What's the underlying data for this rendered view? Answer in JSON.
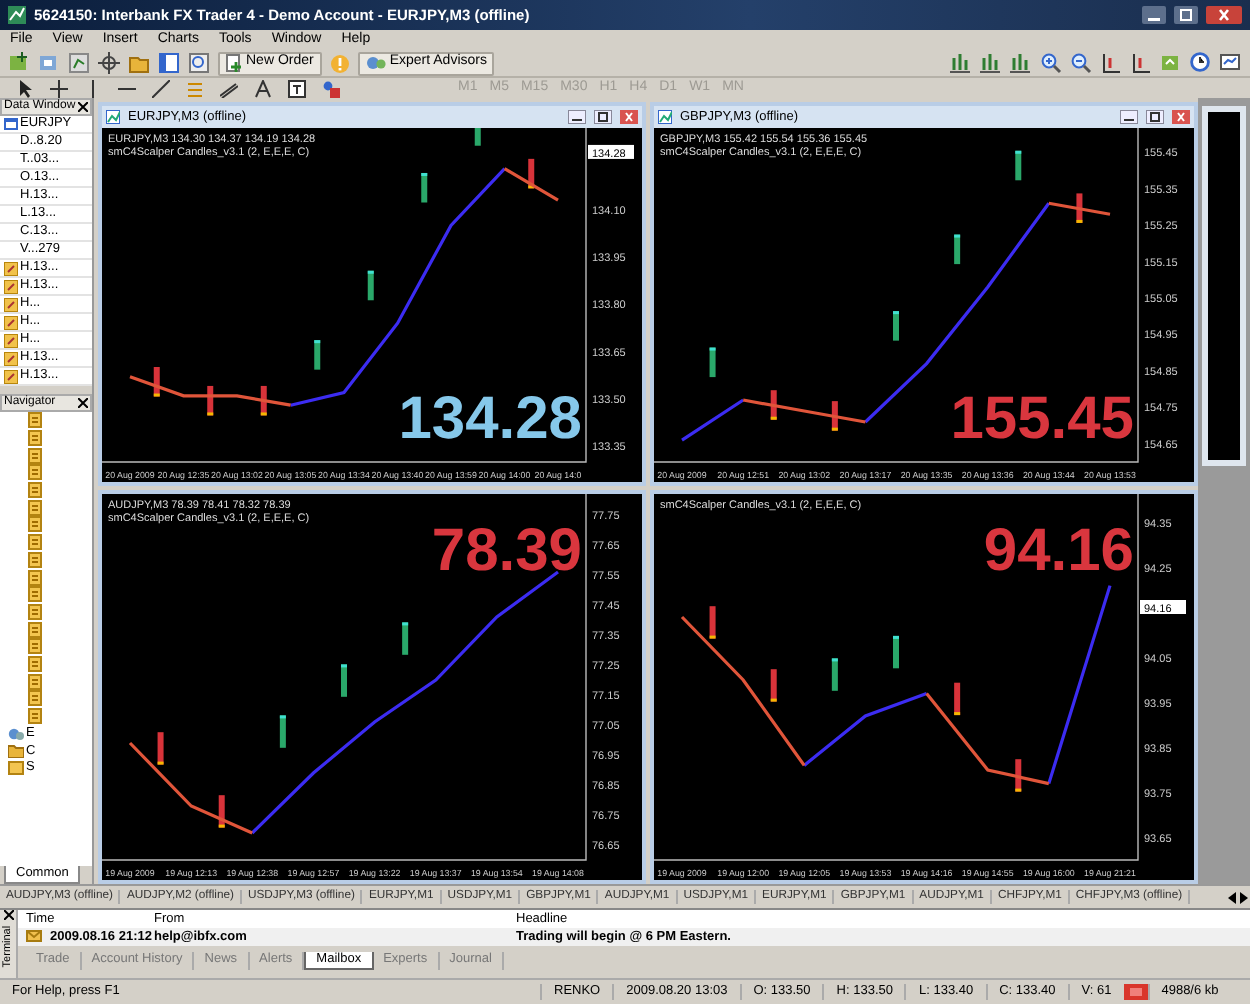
{
  "window": {
    "title": "5624150: Interbank FX Trader 4 - Demo Account - EURJPY,M3 (offline)"
  },
  "menu": [
    "File",
    "View",
    "Insert",
    "Charts",
    "Tools",
    "Window",
    "Help"
  ],
  "toolbar": {
    "buttons": [
      {
        "label": "New Order"
      },
      {
        "label": "Expert Advisors"
      }
    ],
    "periods": [
      {
        "label": "M1",
        "disabled": true
      },
      {
        "label": "M5",
        "disabled": true
      },
      {
        "label": "M15",
        "disabled": true
      },
      {
        "label": "M30",
        "disabled": true
      },
      {
        "label": "H1",
        "disabled": true
      },
      {
        "label": "H4",
        "disabled": true
      },
      {
        "label": "D1",
        "disabled": true
      },
      {
        "label": "W1",
        "disabled": true
      },
      {
        "label": "MN",
        "disabled": true
      }
    ]
  },
  "data_window": {
    "title": "Data Window",
    "symbol": "EURJPY",
    "rows": [
      {
        "kind": "value",
        "text": "D..8.20"
      },
      {
        "kind": "value",
        "text": "T..03..."
      },
      {
        "kind": "value",
        "text": "O.13..."
      },
      {
        "kind": "value",
        "text": "H.13..."
      },
      {
        "kind": "value",
        "text": "L.13..."
      },
      {
        "kind": "value",
        "text": "C.13..."
      },
      {
        "kind": "value",
        "text": "V...279"
      },
      {
        "kind": "buffer",
        "text": "H.13..."
      },
      {
        "kind": "buffer",
        "text": "H.13..."
      },
      {
        "kind": "buffer",
        "text": "H..."
      },
      {
        "kind": "buffer",
        "text": "H..."
      },
      {
        "kind": "buffer",
        "text": "H..."
      },
      {
        "kind": "buffer",
        "text": "H.13..."
      },
      {
        "kind": "buffer",
        "text": "H.13..."
      }
    ]
  },
  "navigator": {
    "title": "Navigator",
    "tab": "Common",
    "items": [
      {
        "kind": "script"
      },
      {
        "kind": "script"
      },
      {
        "kind": "script"
      },
      {
        "kind": "script"
      },
      {
        "kind": "script"
      },
      {
        "kind": "script"
      },
      {
        "kind": "script"
      },
      {
        "kind": "script"
      },
      {
        "kind": "script"
      },
      {
        "kind": "script"
      },
      {
        "kind": "script"
      },
      {
        "kind": "script"
      },
      {
        "kind": "script"
      },
      {
        "kind": "script"
      },
      {
        "kind": "script"
      },
      {
        "kind": "script"
      },
      {
        "kind": "script"
      },
      {
        "kind": "script"
      },
      {
        "kind": "experts",
        "label": "E"
      },
      {
        "kind": "custom",
        "label": "C"
      },
      {
        "kind": "scripts",
        "label": "S"
      }
    ]
  },
  "charts": [
    {
      "title": "EURJPY,M3 (offline)",
      "info": [
        "EURJPY,M3  134.30 134.37 134.19 134.28",
        "smC4Scalper Candles_v3.1 (2, E,E,E, C)"
      ],
      "big_price": {
        "text": "134.28",
        "color": "#86c8ea"
      },
      "chart_data": {
        "type": "line",
        "categories": [
          "20 Aug 2009",
          "20 Aug 12:35",
          "20 Aug 13:02",
          "20 Aug 13:05",
          "20 Aug 13:34",
          "20 Aug 13:40",
          "20 Aug 13:59",
          "20 Aug 14:00",
          "20 Aug 14:0"
        ],
        "series": [
          {
            "color": "#3c2cf2",
            "values": [
              null,
              null,
              null,
              133.48,
              133.52,
              133.74,
              134.05,
              134.23,
              null
            ]
          },
          {
            "color": "#e0553a",
            "values": [
              133.57,
              133.51,
              133.51,
              133.48,
              null,
              null,
              null,
              134.23,
              134.13
            ]
          }
        ],
        "ylim": [
          133.3,
          134.34
        ],
        "yticks": [
          {
            "value": 133.35,
            "label": "133.35"
          },
          {
            "value": 133.5,
            "label": "133.50"
          },
          {
            "value": 133.65,
            "label": "133.65"
          },
          {
            "value": 133.8,
            "label": "133.80"
          },
          {
            "value": 133.95,
            "label": "133.95"
          },
          {
            "value": 134.1,
            "label": "134.10"
          },
          {
            "value": 134.28,
            "label": "134.28"
          }
        ]
      }
    },
    {
      "title": "GBPJPY,M3 (offline)",
      "info": [
        "GBPJPY,M3  155.42 155.54 155.36 155.45",
        "smC4Scalper Candles_v3.1 (2, E,E,E, C)"
      ],
      "big_price": {
        "text": "155.45",
        "color": "#d9363e"
      },
      "chart_data": {
        "type": "line",
        "categories": [
          "20 Aug 2009",
          "20 Aug 12:51",
          "20 Aug 13:02",
          "20 Aug 13:17",
          "20 Aug 13:35",
          "20 Aug 13:36",
          "20 Aug 13:44",
          "20 Aug 13:53"
        ],
        "series": [
          {
            "color": "#3c2cf2",
            "values": [
              154.66,
              154.77,
              null,
              154.71,
              154.87,
              155.08,
              155.31,
              null
            ]
          },
          {
            "color": "#e0553a",
            "values": [
              null,
              154.77,
              154.74,
              154.71,
              null,
              null,
              155.31,
              155.28
            ]
          }
        ],
        "ylim": [
          154.6,
          155.5
        ],
        "yticks": [
          {
            "value": 154.65,
            "label": "154.65"
          },
          {
            "value": 154.75,
            "label": "154.75"
          },
          {
            "value": 154.85,
            "label": "154.85"
          },
          {
            "value": 154.95,
            "label": "154.95"
          },
          {
            "value": 155.05,
            "label": "155.05"
          },
          {
            "value": 155.15,
            "label": "155.15"
          },
          {
            "value": 155.25,
            "label": "155.25"
          },
          {
            "value": 155.35,
            "label": "155.35"
          },
          {
            "value": 155.45,
            "label": "155.45"
          }
        ]
      }
    },
    {
      "info": [
        "AUDJPY,M3  78.39 78.41 78.32 78.39",
        "smC4Scalper Candles_v3.1 (2, E,E,E, C)"
      ],
      "big_price": {
        "text": "78.39",
        "color": "#d9363e"
      },
      "chart_data": {
        "type": "line",
        "categories": [
          "19 Aug 2009",
          "19 Aug 12:13",
          "19 Aug 12:38",
          "19 Aug 12:57",
          "19 Aug 13:22",
          "19 Aug 13:37",
          "19 Aug 13:54",
          "19 Aug 14:08"
        ],
        "series": [
          {
            "color": "#3c2cf2",
            "values": [
              null,
              null,
              76.69,
              76.89,
              77.06,
              77.2,
              77.41,
              77.56
            ]
          },
          {
            "color": "#e0553a",
            "values": [
              76.99,
              76.78,
              76.69,
              null,
              null,
              null,
              null,
              null
            ]
          }
        ],
        "ylim": [
          76.6,
          77.8
        ],
        "yticks": [
          {
            "value": 76.65,
            "label": "76.65"
          },
          {
            "value": 76.75,
            "label": "76.75"
          },
          {
            "value": 76.85,
            "label": "76.85"
          },
          {
            "value": 76.95,
            "label": "76.95"
          },
          {
            "value": 77.05,
            "label": "77.05"
          },
          {
            "value": 77.15,
            "label": "77.15"
          },
          {
            "value": 77.25,
            "label": "77.25"
          },
          {
            "value": 77.35,
            "label": "77.35"
          },
          {
            "value": 77.45,
            "label": "77.45"
          },
          {
            "value": 77.55,
            "label": "77.55"
          },
          {
            "value": 77.65,
            "label": "77.65"
          },
          {
            "value": 77.75,
            "label": "77.75"
          }
        ]
      }
    },
    {
      "info": [
        "smC4Scalper Candles_v3.1 (2, E,E,E, C)"
      ],
      "big_price": {
        "text": "94.16",
        "color": "#d9363e"
      },
      "chart_data": {
        "type": "line",
        "categories": [
          "19 Aug 2009",
          "19 Aug 12:00",
          "19 Aug 12:05",
          "19 Aug 13:53",
          "19 Aug 14:16",
          "19 Aug 14:55",
          "19 Aug 16:00",
          "19 Aug 21:21"
        ],
        "series": [
          {
            "color": "#3c2cf2",
            "values": [
              null,
              null,
              93.81,
              93.92,
              93.97,
              null,
              93.77,
              94.21
            ]
          },
          {
            "color": "#e0553a",
            "values": [
              94.14,
              94.0,
              93.81,
              null,
              93.97,
              93.8,
              93.77,
              null
            ]
          }
        ],
        "ylim": [
          93.6,
          94.4
        ],
        "yticks": [
          {
            "value": 93.65,
            "label": "93.65"
          },
          {
            "value": 93.75,
            "label": "93.75"
          },
          {
            "value": 93.85,
            "label": "93.85"
          },
          {
            "value": 93.95,
            "label": "93.95"
          },
          {
            "value": 94.05,
            "label": "94.05"
          },
          {
            "value": 94.16,
            "label": "94.16"
          },
          {
            "value": 94.25,
            "label": "94.25"
          },
          {
            "value": 94.35,
            "label": "94.35"
          }
        ]
      }
    }
  ],
  "chart_tabs": [
    "AUDJPY,M3 (offline)",
    "AUDJPY,M2 (offline)",
    "USDJPY,M3 (offline)",
    "EURJPY,M1",
    "USDJPY,M1",
    "GBPJPY,M1",
    "AUDJPY,M1",
    "USDJPY,M1",
    "EURJPY,M1",
    "GBPJPY,M1",
    "AUDJPY,M1",
    "CHFJPY,M1",
    "CHFJPY,M3 (offline)"
  ],
  "terminal": {
    "title": "Terminal",
    "columns": [
      "Time",
      "From",
      "Headline"
    ],
    "rows": [
      {
        "time": "2009.08.16 21:12",
        "from": "help@ibfx.com",
        "headline": "Trading will begin @ 6 PM Eastern."
      }
    ],
    "tabs": [
      {
        "label": "Trade",
        "selected": false
      },
      {
        "label": "Account History",
        "selected": false
      },
      {
        "label": "News",
        "selected": false
      },
      {
        "label": "Alerts",
        "selected": false
      },
      {
        "label": "Mailbox",
        "selected": true
      },
      {
        "label": "Experts",
        "selected": false
      },
      {
        "label": "Journal",
        "selected": false
      }
    ]
  },
  "status_bar": [
    "For Help, press F1",
    "RENKO",
    "2009.08.20 13:03",
    "O: 133.50",
    "H: 133.50",
    "L: 133.40",
    "C: 133.40",
    "V: 61",
    "4988/6 kb"
  ]
}
